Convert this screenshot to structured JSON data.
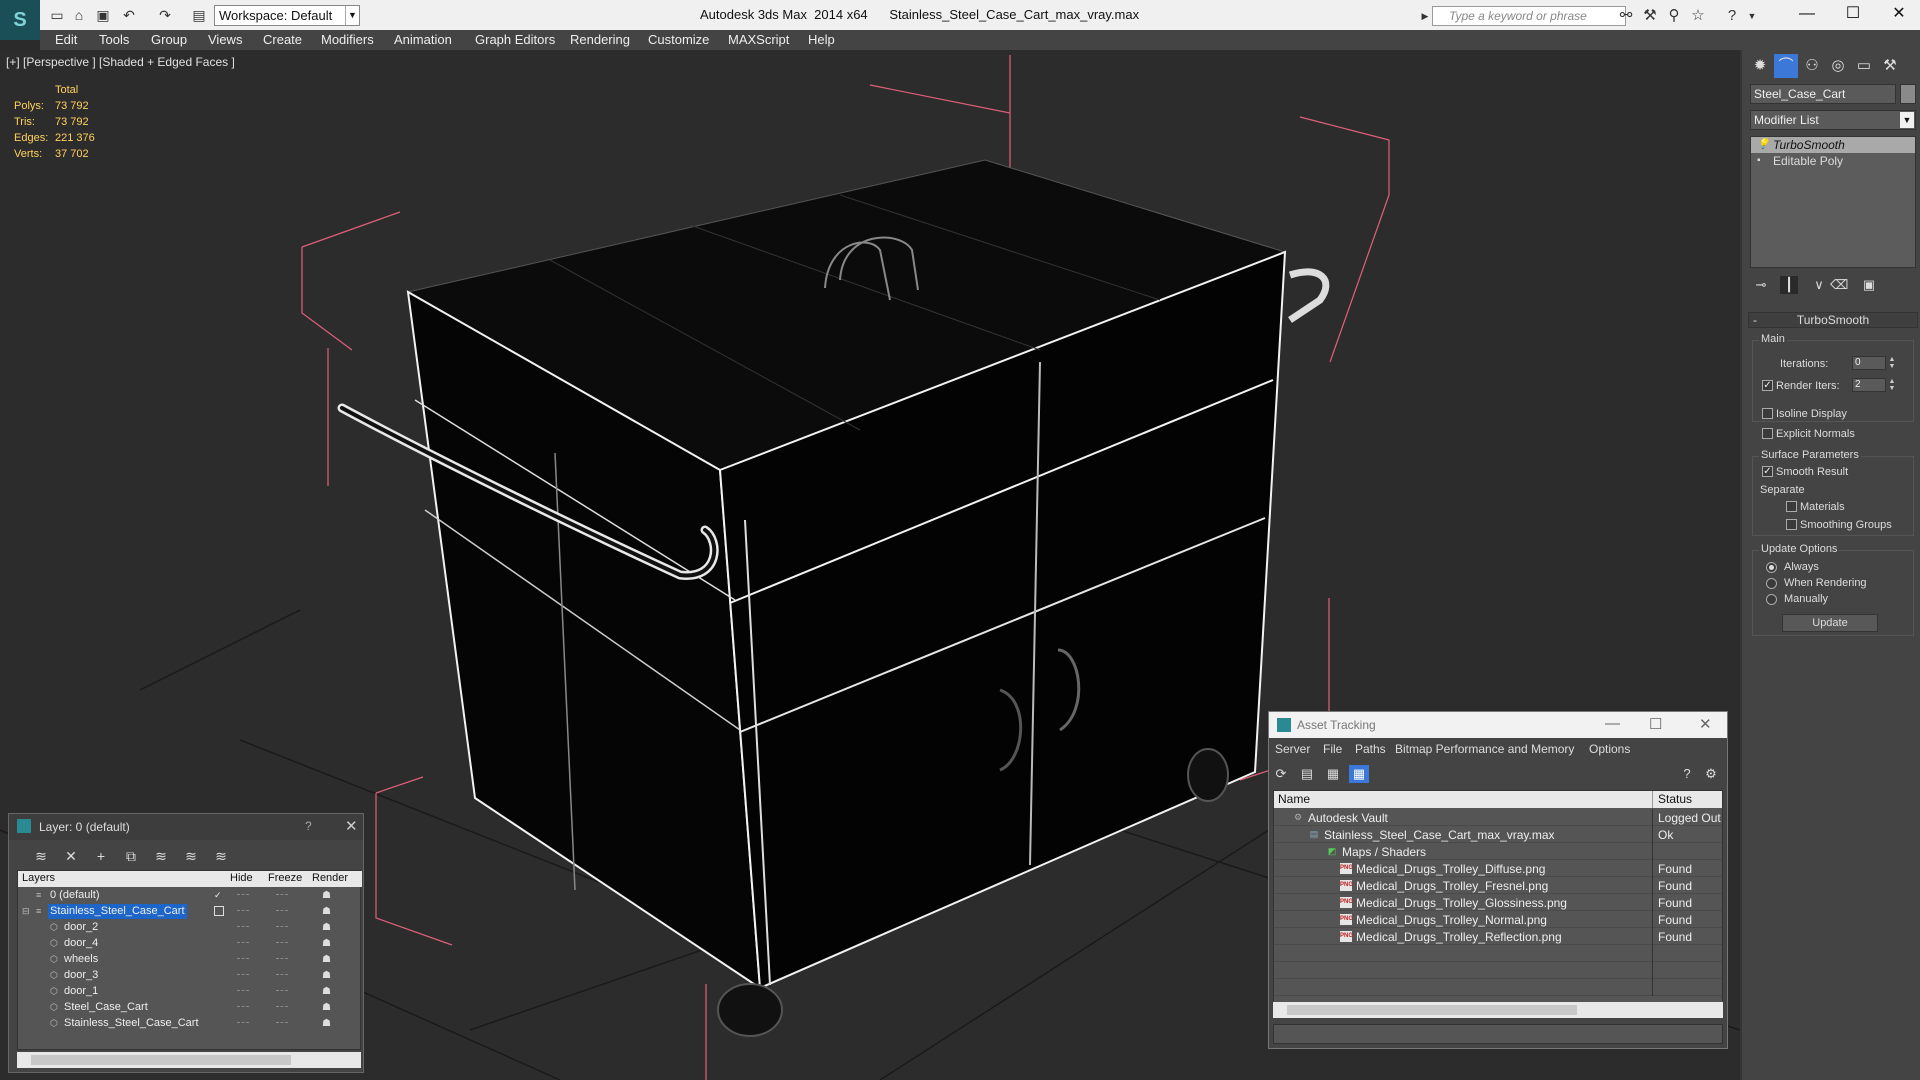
{
  "titlebar": {
    "workspace": "Workspace: Default",
    "app_name": "Autodesk 3ds Max  2014 x64",
    "file_name": "Stainless_Steel_Case_Cart_max_vray.max",
    "search_placeholder": "Type a keyword or phrase"
  },
  "menu": [
    "Edit",
    "Tools",
    "Group",
    "Views",
    "Create",
    "Modifiers",
    "Animation",
    "Graph Editors",
    "Rendering",
    "Customize",
    "MAXScript",
    "Help"
  ],
  "viewport": {
    "label": "[+] [Perspective ] [Shaded + Edged Faces ]",
    "stats_header": "Total",
    "stats": [
      {
        "label": "Polys:",
        "value": "73 792"
      },
      {
        "label": "Tris:",
        "value": "73 792"
      },
      {
        "label": "Edges:",
        "value": "221 376"
      },
      {
        "label": "Verts:",
        "value": "37 702"
      }
    ]
  },
  "command_panel": {
    "object_name": "Steel_Case_Cart",
    "modifier_list": "Modifier List",
    "stack": [
      "TurboSmooth",
      "Editable Poly"
    ],
    "rollout": "TurboSmooth",
    "main_group": "Main",
    "iterations_label": "Iterations:",
    "iterations_value": "0",
    "render_iters_label": "Render Iters:",
    "render_iters_value": "2",
    "isoline": "Isoline Display",
    "explicit_normals": "Explicit Normals",
    "surface_group": "Surface Parameters",
    "smooth_result": "Smooth Result",
    "separate": "Separate",
    "materials": "Materials",
    "smoothing_groups": "Smoothing Groups",
    "update_group": "Update Options",
    "always": "Always",
    "when_rendering": "When Rendering",
    "manually": "Manually",
    "update_button": "Update"
  },
  "layer_panel": {
    "title": "Layer: 0 (default)",
    "help": "?",
    "columns": [
      "Layers",
      "Hide",
      "Freeze",
      "Render"
    ],
    "rows": [
      {
        "name": "0 (default)"
      },
      {
        "name": "Stainless_Steel_Case_Cart"
      },
      {
        "name": "door_2"
      },
      {
        "name": "door_4"
      },
      {
        "name": "wheels"
      },
      {
        "name": "door_3"
      },
      {
        "name": "door_1"
      },
      {
        "name": "Steel_Case_Cart"
      },
      {
        "name": "Stainless_Steel_Case_Cart"
      }
    ]
  },
  "asset_tracking": {
    "title": "Asset Tracking",
    "menu": [
      "Server",
      "File",
      "Paths",
      "Bitmap Performance and Memory",
      "Options"
    ],
    "columns": [
      "Name",
      "Status"
    ],
    "rows": [
      {
        "name": "Autodesk Vault",
        "status": "Logged Out"
      },
      {
        "name": "Stainless_Steel_Case_Cart_max_vray.max",
        "status": "Ok"
      },
      {
        "name": "Maps / Shaders",
        "status": ""
      },
      {
        "name": "Medical_Drugs_Trolley_Diffuse.png",
        "status": "Found"
      },
      {
        "name": "Medical_Drugs_Trolley_Fresnel.png",
        "status": "Found"
      },
      {
        "name": "Medical_Drugs_Trolley_Glossiness.png",
        "status": "Found"
      },
      {
        "name": "Medical_Drugs_Trolley_Normal.png",
        "status": "Found"
      },
      {
        "name": "Medical_Drugs_Trolley_Reflection.png",
        "status": "Found"
      }
    ]
  },
  "colors": {
    "viewport_bg": "#2c2c2c",
    "stats_text": "#ffd25a",
    "selection_blue": "#1d66c8",
    "bbox_pink": "#e0607a"
  }
}
